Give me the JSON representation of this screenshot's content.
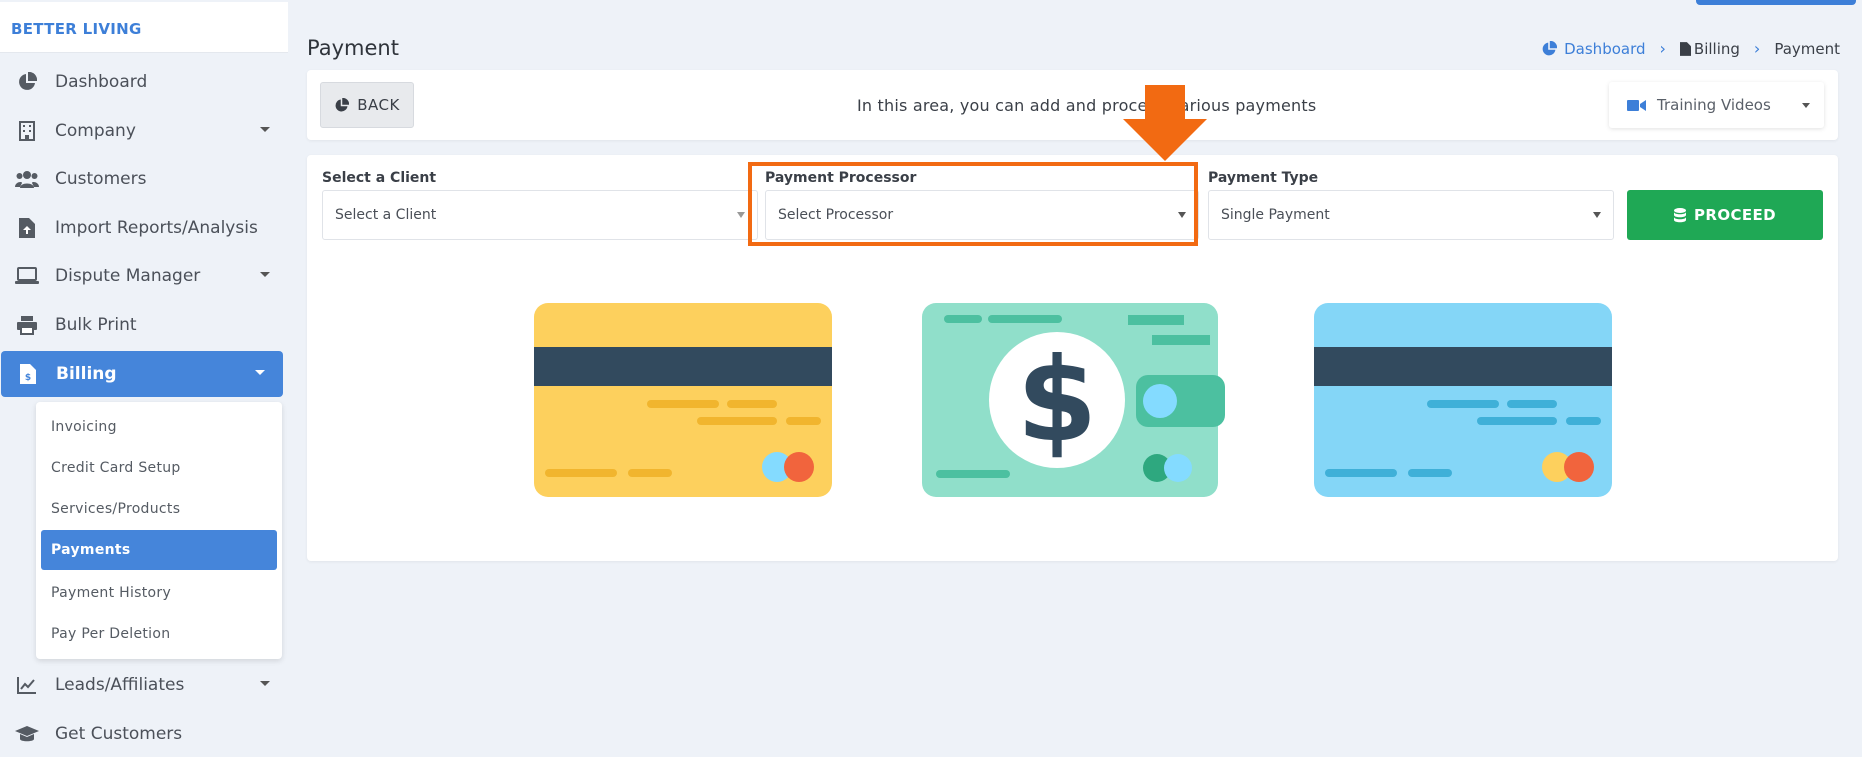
{
  "brand": "BETTER LIVING",
  "sidebar": {
    "items": [
      {
        "label": "Dashboard",
        "icon": "pie-chart-icon"
      },
      {
        "label": "Company",
        "icon": "building-icon"
      },
      {
        "label": "Customers",
        "icon": "users-icon"
      },
      {
        "label": "Import Reports/Analysis",
        "icon": "file-upload-icon"
      },
      {
        "label": "Dispute Manager",
        "icon": "laptop-icon"
      },
      {
        "label": "Bulk Print",
        "icon": "printer-icon"
      },
      {
        "label": "Billing",
        "icon": "invoice-icon"
      },
      {
        "label": "Leads/Affiliates",
        "icon": "line-chart-icon"
      },
      {
        "label": "Get Customers",
        "icon": "graduation-cap-icon"
      }
    ],
    "billing_submenu": [
      "Invoicing",
      "Credit Card Setup",
      "Services/Products",
      "Payments",
      "Payment History",
      "Pay Per Deletion"
    ]
  },
  "page": {
    "title": "Payment",
    "breadcrumb": [
      "Dashboard",
      "Billing",
      "Payment"
    ]
  },
  "toolbar": {
    "back_label": "BACK",
    "info_text": "In this area, you can add and process various payments",
    "training_label": "Training Videos"
  },
  "form": {
    "client_label": "Select a Client",
    "client_value": "Select a Client",
    "processor_label": "Payment Processor",
    "processor_value": "Select Processor",
    "type_label": "Payment Type",
    "type_value": "Single Payment",
    "proceed_label": "PROCEED"
  },
  "colors": {
    "accent": "#4585da",
    "success": "#1fa855",
    "annotation": "#f26a12"
  }
}
